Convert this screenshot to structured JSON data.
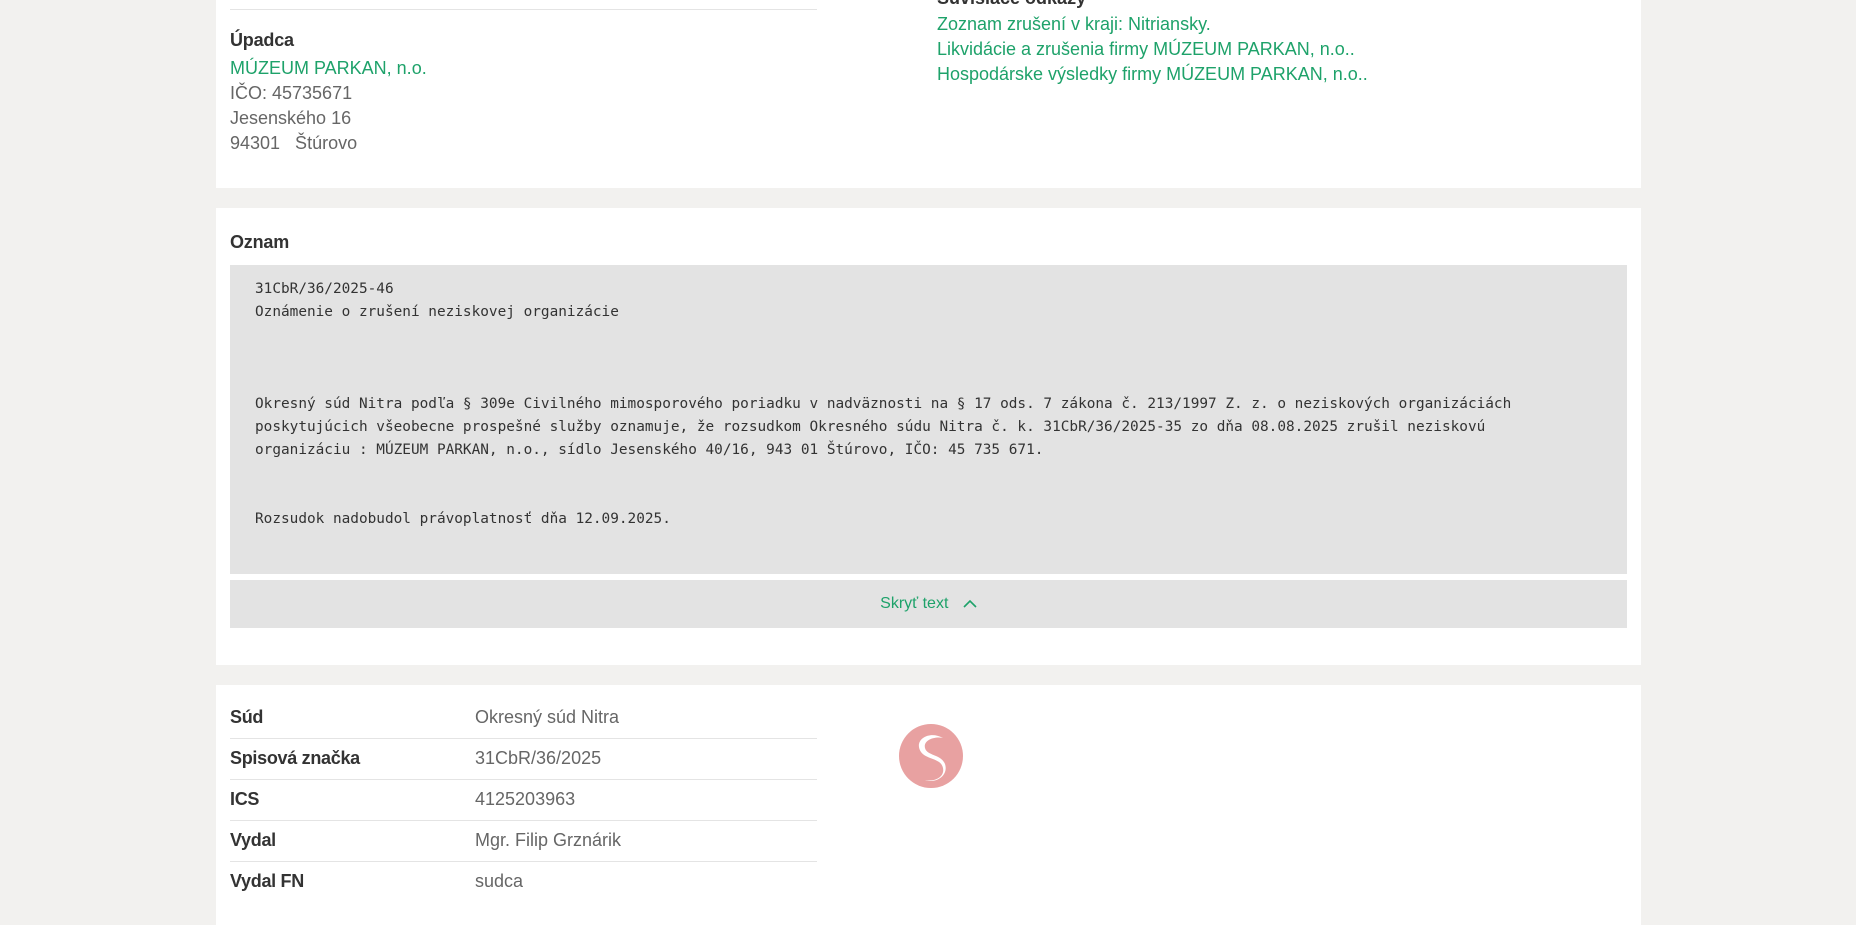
{
  "upadca": {
    "title": "Úpadca",
    "name_link": "MÚZEUM PARKAN, n.o.",
    "ico": "IČO: 45735671",
    "street": "Jesenského 16",
    "city": "94301   Štúrovo"
  },
  "related": {
    "title": "Súvisiace odkazy",
    "links": [
      "Zoznam zrušení v kraji: Nitriansky.",
      "Likvidácie a zrušenia firmy MÚZEUM PARKAN, n.o..",
      "Hospodárske výsledky firmy MÚZEUM PARKAN, n.o.."
    ]
  },
  "oznam": {
    "title": "Oznam",
    "lines": [
      "31CbR/36/2025-46",
      "Oznámenie o zrušení neziskovej organizácie",
      "Okresný súd Nitra podľa § 309e Civilného mimosporového poriadku v nadväznosti na § 17 ods. 7 zákona č. 213/1997 Z. z. o neziskových organizáciách",
      "poskytujúcich všeobecne prospešné služby oznamuje, že rozsudkom Okresného súdu Nitra č. k. 31CbR/36/2025-35 zo dňa 08.08.2025 zrušil neziskovú",
      "organizáciu : MÚZEUM PARKAN, n.o., sídlo Jesenského 40/16, 943 01 Štúrovo, IČO: 45 735 671.",
      "Rozsudok nadobudol právoplatnosť dňa 12.09.2025."
    ],
    "toggle_label": "Skryť text"
  },
  "info": {
    "rows": [
      {
        "key": "Súd",
        "value": "Okresný súd Nitra"
      },
      {
        "key": "Spisová značka",
        "value": "31CbR/36/2025"
      },
      {
        "key": "ICS",
        "value": "4125203963"
      },
      {
        "key": "Vydal",
        "value": "Mgr. Filip Grznárik"
      },
      {
        "key": "Vydal FN",
        "value": "sudca"
      }
    ]
  },
  "colors": {
    "link": "#1ea26a",
    "logo": "#e8a1a1",
    "page_bg": "#f2f1ef",
    "box_bg": "#e3e3e3"
  }
}
